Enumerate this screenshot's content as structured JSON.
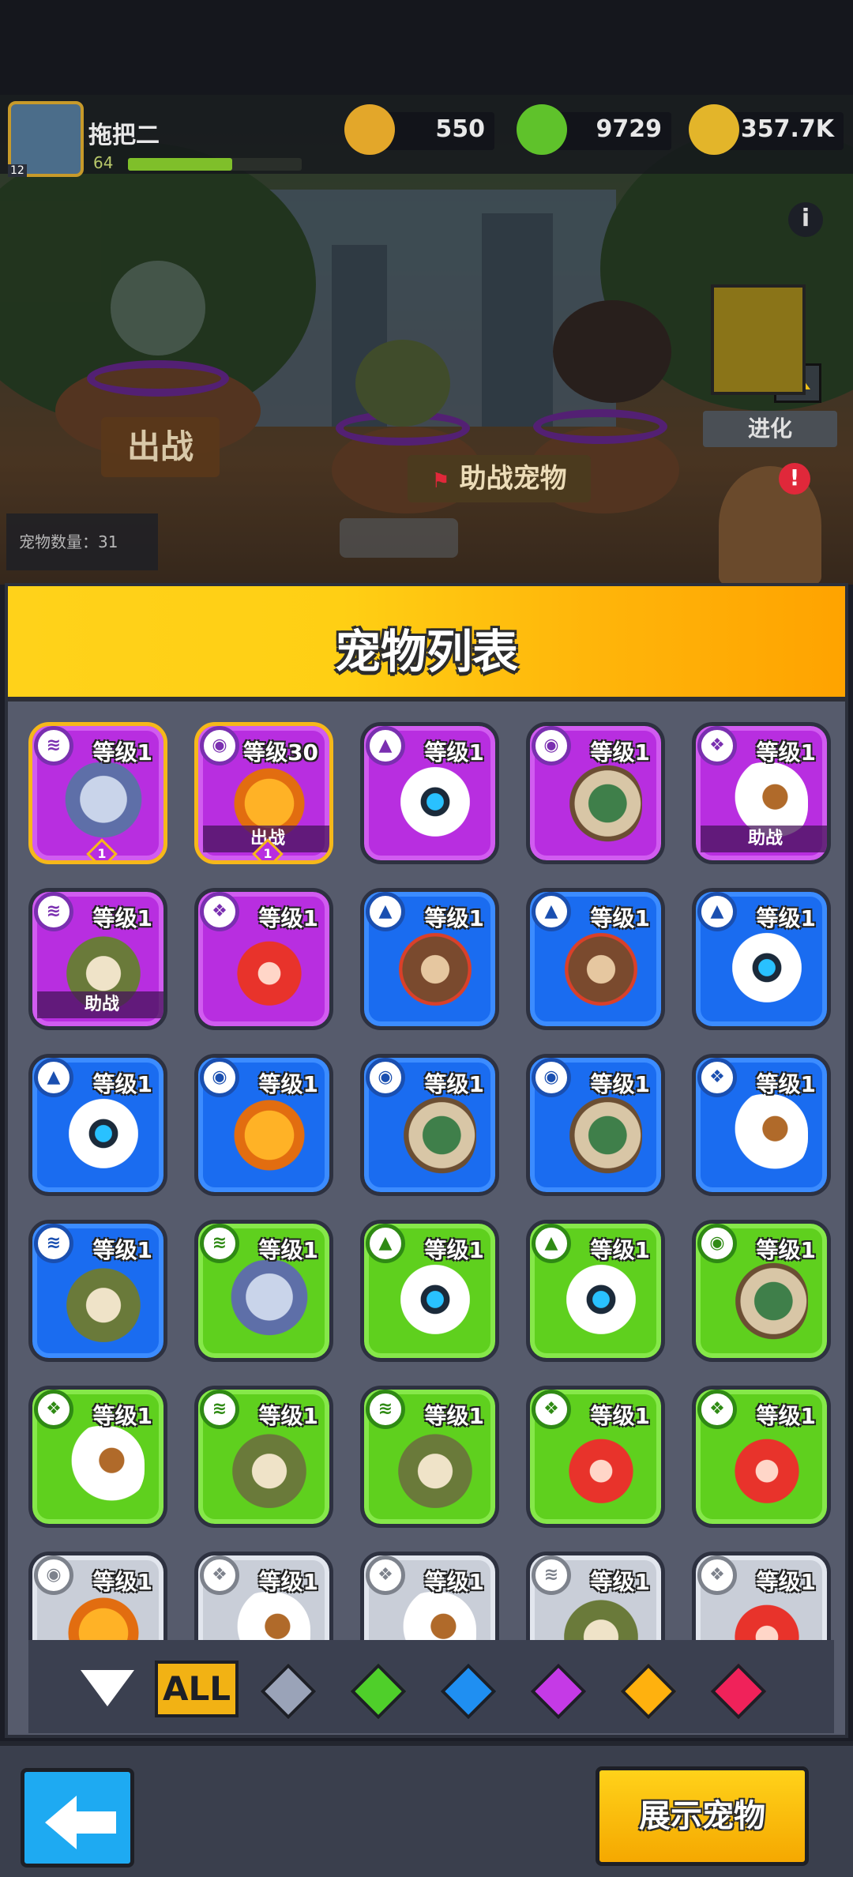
{
  "player": {
    "name": "拖把二",
    "level": "64",
    "avatar_level": "12",
    "xp_fraction": 0.6
  },
  "resources": [
    {
      "name": "coin-icon",
      "value": "550",
      "color": "#e3a72a"
    },
    {
      "name": "gem-cube-icon",
      "value": "9729",
      "color": "#5fc22b"
    },
    {
      "name": "gold-plus-icon",
      "value": "357.7K",
      "color": "#e3b52a"
    }
  ],
  "scene": {
    "deploy_label": "出战",
    "assist_pets_label": "助战宠物",
    "evolve_label": "进化",
    "pet_count_label": "宠物数量：31",
    "alert_badge": "!"
  },
  "panel": {
    "title": "宠物列表"
  },
  "pets": [
    {
      "rarity": "purple",
      "species": "cat",
      "level": "等级1",
      "tag": "",
      "star": "1",
      "selected": true,
      "type_icon": "coins-type-icon"
    },
    {
      "rarity": "purple",
      "species": "fish",
      "level": "等级30",
      "tag": "出战",
      "star": "1",
      "selected": true,
      "type_icon": "turtle-shell-type-icon"
    },
    {
      "rarity": "purple",
      "species": "robot",
      "level": "等级1",
      "tag": "",
      "star": "",
      "selected": false,
      "type_icon": "beast-type-icon"
    },
    {
      "rarity": "purple",
      "species": "turtle",
      "level": "等级1",
      "tag": "",
      "star": "",
      "selected": false,
      "type_icon": "turtle-shell-type-icon"
    },
    {
      "rarity": "purple",
      "species": "eagle",
      "level": "等级1",
      "tag": "助战",
      "star": "",
      "selected": false,
      "type_icon": "bird-type-icon"
    },
    {
      "rarity": "purple",
      "species": "frog",
      "level": "等级1",
      "tag": "助战",
      "star": "",
      "selected": false,
      "type_icon": "coins-type-icon"
    },
    {
      "rarity": "purple",
      "species": "crab",
      "level": "等级1",
      "tag": "",
      "star": "",
      "selected": false,
      "type_icon": "bird-type-icon"
    },
    {
      "rarity": "blue",
      "species": "dog",
      "level": "等级1",
      "tag": "",
      "star": "",
      "selected": false,
      "type_icon": "beast-type-icon"
    },
    {
      "rarity": "blue",
      "species": "dog",
      "level": "等级1",
      "tag": "",
      "star": "",
      "selected": false,
      "type_icon": "beast-type-icon"
    },
    {
      "rarity": "blue",
      "species": "robot",
      "level": "等级1",
      "tag": "",
      "star": "",
      "selected": false,
      "type_icon": "beast-type-icon"
    },
    {
      "rarity": "blue",
      "species": "robot",
      "level": "等级1",
      "tag": "",
      "star": "",
      "selected": false,
      "type_icon": "beast-type-icon"
    },
    {
      "rarity": "blue",
      "species": "fish",
      "level": "等级1",
      "tag": "",
      "star": "",
      "selected": false,
      "type_icon": "turtle-shell-type-icon"
    },
    {
      "rarity": "blue",
      "species": "turtle",
      "level": "等级1",
      "tag": "",
      "star": "",
      "selected": false,
      "type_icon": "turtle-shell-type-icon"
    },
    {
      "rarity": "blue",
      "species": "turtle",
      "level": "等级1",
      "tag": "",
      "star": "",
      "selected": false,
      "type_icon": "turtle-shell-type-icon"
    },
    {
      "rarity": "blue",
      "species": "eagle",
      "level": "等级1",
      "tag": "",
      "star": "",
      "selected": false,
      "type_icon": "bird-type-icon"
    },
    {
      "rarity": "blue",
      "species": "frog",
      "level": "等级1",
      "tag": "",
      "star": "",
      "selected": false,
      "type_icon": "coins-type-icon"
    },
    {
      "rarity": "green",
      "species": "cat",
      "level": "等级1",
      "tag": "",
      "star": "",
      "selected": false,
      "type_icon": "coins-type-icon"
    },
    {
      "rarity": "green",
      "species": "robot",
      "level": "等级1",
      "tag": "",
      "star": "",
      "selected": false,
      "type_icon": "beast-type-icon"
    },
    {
      "rarity": "green",
      "species": "robot",
      "level": "等级1",
      "tag": "",
      "star": "",
      "selected": false,
      "type_icon": "beast-type-icon"
    },
    {
      "rarity": "green",
      "species": "turtle",
      "level": "等级1",
      "tag": "",
      "star": "",
      "selected": false,
      "type_icon": "turtle-shell-type-icon"
    },
    {
      "rarity": "green",
      "species": "eagle",
      "level": "等级1",
      "tag": "",
      "star": "",
      "selected": false,
      "type_icon": "bird-type-icon"
    },
    {
      "rarity": "green",
      "species": "frog",
      "level": "等级1",
      "tag": "",
      "star": "",
      "selected": false,
      "type_icon": "coins-type-icon"
    },
    {
      "rarity": "green",
      "species": "frog",
      "level": "等级1",
      "tag": "",
      "star": "",
      "selected": false,
      "type_icon": "coins-type-icon"
    },
    {
      "rarity": "green",
      "species": "crab",
      "level": "等级1",
      "tag": "",
      "star": "",
      "selected": false,
      "type_icon": "bird-type-icon"
    },
    {
      "rarity": "green",
      "species": "crab",
      "level": "等级1",
      "tag": "",
      "star": "",
      "selected": false,
      "type_icon": "bird-type-icon"
    },
    {
      "rarity": "grey",
      "species": "fish",
      "level": "等级1",
      "tag": "",
      "star": "",
      "selected": false,
      "type_icon": "turtle-shell-type-icon"
    },
    {
      "rarity": "grey",
      "species": "eagle",
      "level": "等级1",
      "tag": "",
      "star": "",
      "selected": false,
      "type_icon": "bird-type-icon"
    },
    {
      "rarity": "grey",
      "species": "eagle",
      "level": "等级1",
      "tag": "",
      "star": "",
      "selected": false,
      "type_icon": "bird-type-icon"
    },
    {
      "rarity": "grey",
      "species": "frog",
      "level": "等级1",
      "tag": "",
      "star": "",
      "selected": false,
      "type_icon": "coins-type-icon"
    },
    {
      "rarity": "grey",
      "species": "crab",
      "level": "等级1",
      "tag": "",
      "star": "",
      "selected": false,
      "type_icon": "bird-type-icon"
    }
  ],
  "filters": {
    "all_label": "ALL",
    "gems": [
      {
        "name": "grey-gem-filter",
        "color": "#9aa3b8"
      },
      {
        "name": "green-gem-filter",
        "color": "#4fcf2a"
      },
      {
        "name": "blue-gem-filter",
        "color": "#1f8ff2"
      },
      {
        "name": "purple-gem-filter",
        "color": "#c53ae6"
      },
      {
        "name": "orange-gem-filter",
        "color": "#ffb10e"
      },
      {
        "name": "red-gem-filter",
        "color": "#f0225a"
      }
    ]
  },
  "bottom": {
    "show_pet_label": "展示宠物"
  }
}
